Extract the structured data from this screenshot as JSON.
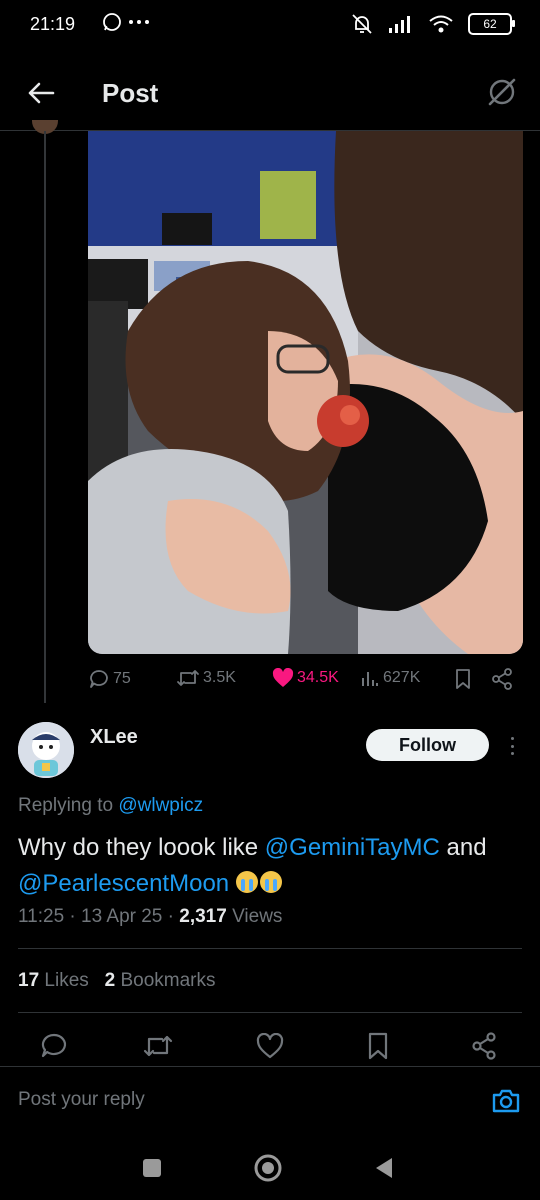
{
  "status": {
    "time": "21:19",
    "battery": "62"
  },
  "header": {
    "title": "Post"
  },
  "original_post": {
    "actions": {
      "replies": "75",
      "reposts": "3.5K",
      "likes": "34.5K",
      "views": "627K"
    }
  },
  "reply": {
    "author": "XLee",
    "follow_label": "Follow",
    "replying_prefix": "Replying to",
    "replying_handle": "@wlwpicz",
    "text_part1": "Why do they loook like",
    "mention1": "@GeminiTayMC",
    "text_part2": "and",
    "mention2": "@PearlescentMoon",
    "time": "11:25",
    "date": "13 Apr 25",
    "views_count": "2,317",
    "views_label": "Views",
    "likes_count": "17",
    "likes_label": "Likes",
    "bookmarks_count": "2",
    "bookmarks_label": "Bookmarks"
  },
  "composer": {
    "placeholder": "Post your reply"
  },
  "colors": {
    "accent": "#1d9bf0",
    "like": "#f91880",
    "muted": "#71767b"
  }
}
